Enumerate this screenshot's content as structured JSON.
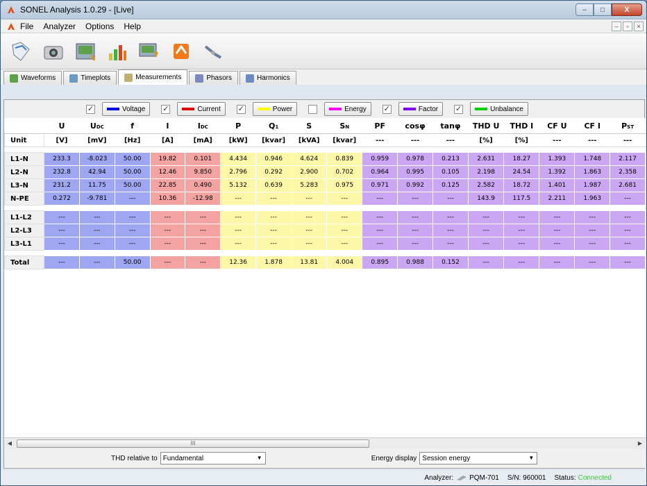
{
  "window": {
    "title": "SONEL Analysis 1.0.29 - [Live]",
    "minimize": "–",
    "maximize": "□",
    "close": "X"
  },
  "menu": {
    "items": [
      "File",
      "Analyzer",
      "Options",
      "Help"
    ]
  },
  "mdi": {
    "minimize": "–",
    "restore": "▫",
    "close": "×"
  },
  "toolbar": {
    "icons": [
      "open-icon",
      "camera-icon",
      "analyzer-icon",
      "bar-chart-icon",
      "download-icon",
      "import-icon",
      "connect-icon"
    ]
  },
  "tabs": [
    {
      "label": "Waveforms",
      "icon": "waveform-icon"
    },
    {
      "label": "Timeplots",
      "icon": "clock-icon"
    },
    {
      "label": "Measurements",
      "icon": "table-icon",
      "active": true
    },
    {
      "label": "Phasors",
      "icon": "phasor-icon"
    },
    {
      "label": "Harmonics",
      "icon": "harmonics-icon"
    }
  ],
  "legend": [
    {
      "label": "Voltage",
      "checked": true,
      "color": "#0000e0"
    },
    {
      "label": "Current",
      "checked": true,
      "color": "#e00000"
    },
    {
      "label": "Power",
      "checked": true,
      "color": "#ffff00"
    },
    {
      "label": "Energy",
      "checked": false,
      "color": "#ff00ff"
    },
    {
      "label": "Factor",
      "checked": true,
      "color": "#8000ff"
    },
    {
      "label": "Unbalance",
      "checked": true,
      "color": "#00d000"
    }
  ],
  "table": {
    "headers": [
      "U",
      "U",
      "f",
      "I",
      "I",
      "P",
      "Q",
      "S",
      "S",
      "PF",
      "cosφ",
      "tanφ",
      "THD U",
      "THD I",
      "CF U",
      "CF I",
      "P"
    ],
    "header_subs": [
      "",
      "DC",
      "",
      "",
      "DC",
      "",
      "1",
      "",
      "N",
      "",
      "",
      "",
      "",
      "",
      "",
      "",
      "ST"
    ],
    "unit_label": "Unit",
    "units": [
      "[V]",
      "[mV]",
      "[Hz]",
      "[A]",
      "[mA]",
      "[kW]",
      "[kvar]",
      "[kVA]",
      "[kvar]",
      "---",
      "---",
      "---",
      "[%]",
      "[%]",
      "---",
      "---",
      "---"
    ],
    "groups": [
      [
        {
          "label": "L1-N",
          "values": [
            "233.3",
            "-8.023",
            "50.00",
            "19.82",
            "0.101",
            "4.434",
            "0.946",
            "4.624",
            "0.839",
            "0.959",
            "0.978",
            "0.213",
            "2.631",
            "18.27",
            "1.393",
            "1.748",
            "2.117"
          ]
        },
        {
          "label": "L2-N",
          "values": [
            "232.8",
            "42.94",
            "50.00",
            "12.46",
            "9.850",
            "2.796",
            "0.292",
            "2.900",
            "0.702",
            "0.964",
            "0.995",
            "0.105",
            "2.198",
            "24.54",
            "1.392",
            "1.863",
            "2.358"
          ]
        },
        {
          "label": "L3-N",
          "values": [
            "231.2",
            "11.75",
            "50.00",
            "22.85",
            "0.490",
            "5.132",
            "0.639",
            "5.283",
            "0.975",
            "0.971",
            "0.992",
            "0.125",
            "2.582",
            "18.72",
            "1.401",
            "1.987",
            "2.681"
          ]
        },
        {
          "label": "N-PE",
          "values": [
            "0.272",
            "-9.781",
            "---",
            "10.36",
            "-12.98",
            "---",
            "---",
            "---",
            "---",
            "---",
            "---",
            "---",
            "143.9",
            "117.5",
            "2.211",
            "1.963",
            "---"
          ]
        }
      ],
      [
        {
          "label": "L1-L2",
          "values": [
            "---",
            "---",
            "---",
            "---",
            "---",
            "---",
            "---",
            "---",
            "---",
            "---",
            "---",
            "---",
            "---",
            "---",
            "---",
            "---",
            "---"
          ]
        },
        {
          "label": "L2-L3",
          "values": [
            "---",
            "---",
            "---",
            "---",
            "---",
            "---",
            "---",
            "---",
            "---",
            "---",
            "---",
            "---",
            "---",
            "---",
            "---",
            "---",
            "---"
          ]
        },
        {
          "label": "L3-L1",
          "values": [
            "---",
            "---",
            "---",
            "---",
            "---",
            "---",
            "---",
            "---",
            "---",
            "---",
            "---",
            "---",
            "---",
            "---",
            "---",
            "---",
            "---"
          ]
        }
      ],
      [
        {
          "label": "Total",
          "values": [
            "---",
            "---",
            "50.00",
            "---",
            "---",
            "12.36",
            "1.878",
            "13.81",
            "4.004",
            "0.895",
            "0.988",
            "0.152",
            "---",
            "---",
            "---",
            "---",
            "---"
          ]
        }
      ]
    ],
    "column_colors": [
      "lblue",
      "lblue",
      "lblue",
      "lred",
      "lred",
      "lyel",
      "lyel",
      "lyel",
      "lyel",
      "lpur",
      "lpur",
      "lpur",
      "lpur",
      "lpur",
      "lpur",
      "lpur",
      "lpur"
    ]
  },
  "scroll": {
    "thumb_label": "III",
    "left": "◀",
    "right": "▶"
  },
  "bottom": {
    "thd_label": "THD relative to",
    "thd_value": "Fundamental",
    "energy_label": "Energy display",
    "energy_value": "Session energy"
  },
  "status": {
    "analyzer_label": "Analyzer:",
    "analyzer_value": "PQM-701",
    "serial": "S/N: 960001",
    "status_label": "Status:",
    "status_value": "Connected"
  }
}
